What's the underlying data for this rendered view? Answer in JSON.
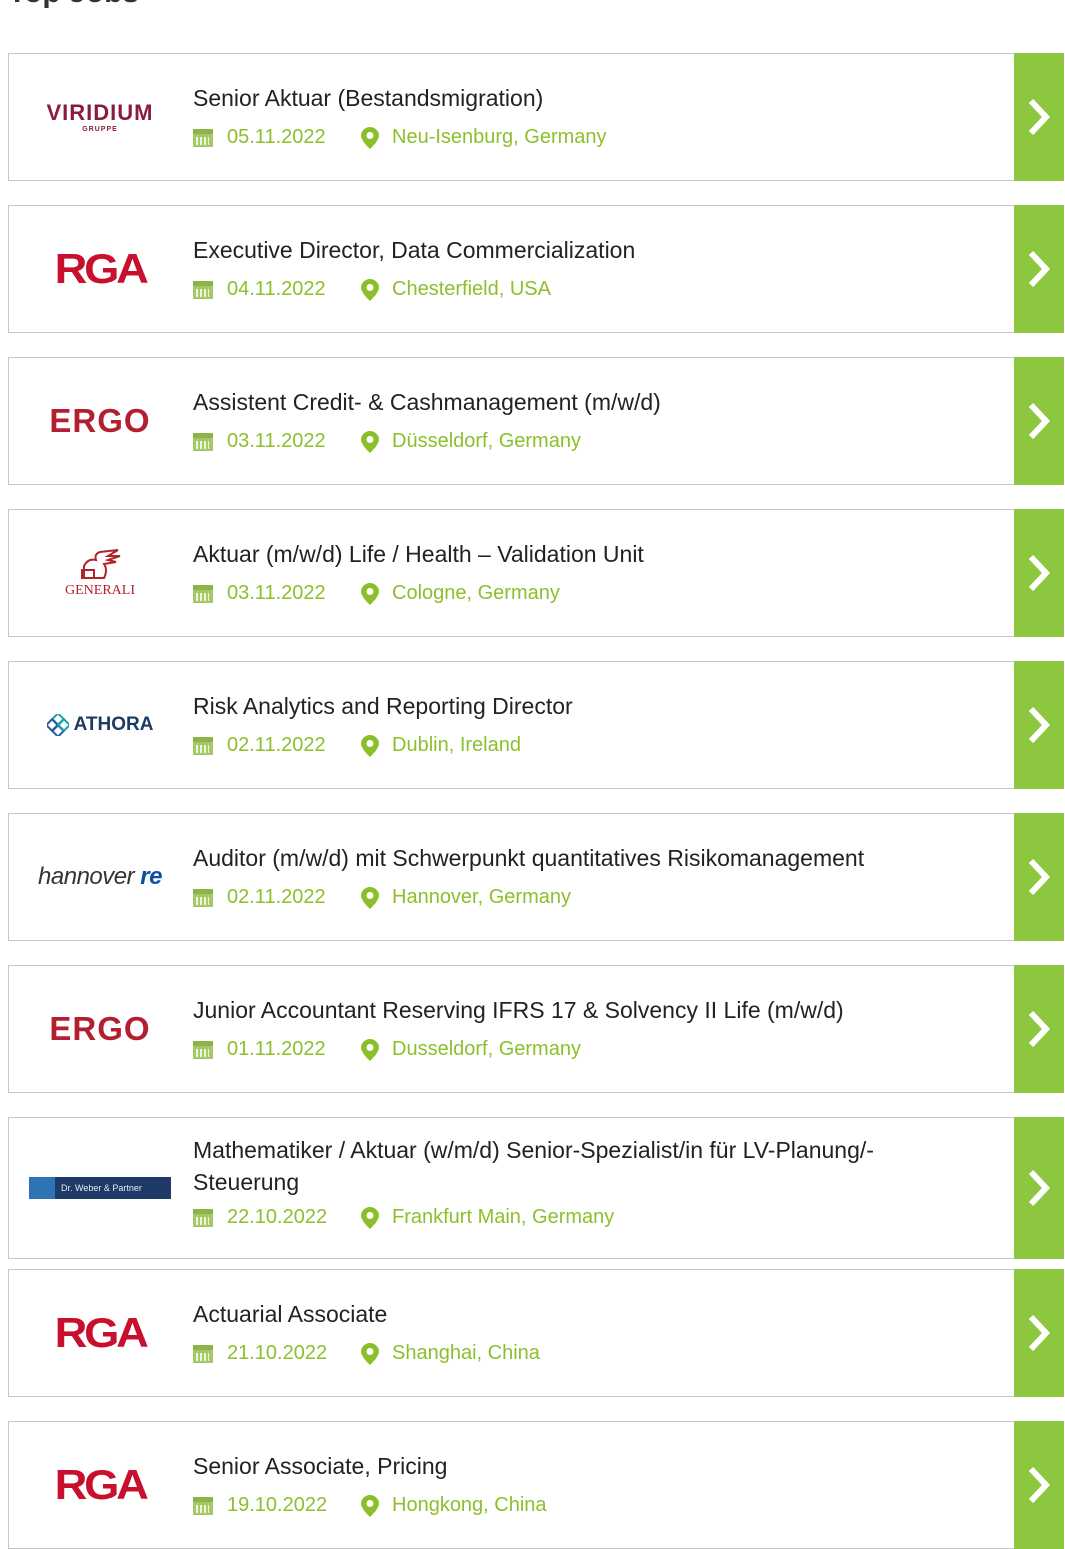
{
  "heading": "Top Jobs",
  "jobs": [
    {
      "company": "VIRIDIUM",
      "company_sub": "GRUPPE",
      "title": "Senior Aktuar (Bestandsmigration)",
      "date": "05.11.2022",
      "location": "Neu-Isenburg, Germany"
    },
    {
      "company": "RGA",
      "title": "Executive Director, Data Commercialization",
      "date": "04.11.2022",
      "location": "Chesterfield, USA"
    },
    {
      "company": "ERGO",
      "title": "Assistent Credit- & Cashmanagement (m/w/d)",
      "date": "03.11.2022",
      "location": "Düsseldorf, Germany"
    },
    {
      "company": "GENERALI",
      "title": "Aktuar (m/w/d) Life / Health – Validation Unit",
      "date": "03.11.2022",
      "location": "Cologne, Germany"
    },
    {
      "company": "ATHORA",
      "title": "Risk Analytics and Reporting Director",
      "date": "02.11.2022",
      "location": "Dublin, Ireland"
    },
    {
      "company": "hannover",
      "company_sub": "re",
      "title": "Auditor (m/w/d) mit Schwerpunkt quantitatives Risikomanagement",
      "date": "02.11.2022",
      "location": "Hannover, Germany"
    },
    {
      "company": "ERGO",
      "title": "Junior Accountant Reserving IFRS 17 & Solvency II Life (m/w/d)",
      "date": "01.11.2022",
      "location": "Dusseldorf, Germany"
    },
    {
      "company": "Dr. Weber & Partner",
      "title": "Mathematiker / Aktuar (w/m/d) Senior-Spezialist/in für LV-Planung/-Steuerung",
      "date": "22.10.2022",
      "location": "Frankfurt Main, Germany"
    },
    {
      "company": "RGA",
      "title": "Actuarial Associate",
      "date": "21.10.2022",
      "location": "Shanghai, China"
    },
    {
      "company": "RGA",
      "title": "Senior Associate, Pricing",
      "date": "19.10.2022",
      "location": "Hongkong, China"
    }
  ],
  "icons": {
    "date": "calendar-icon",
    "location": "map-pin-icon",
    "open": "chevron-right-icon"
  },
  "colors": {
    "accent": "#8dc63f",
    "meta_text": "#8dbf2d",
    "border": "#c6c6c6"
  }
}
